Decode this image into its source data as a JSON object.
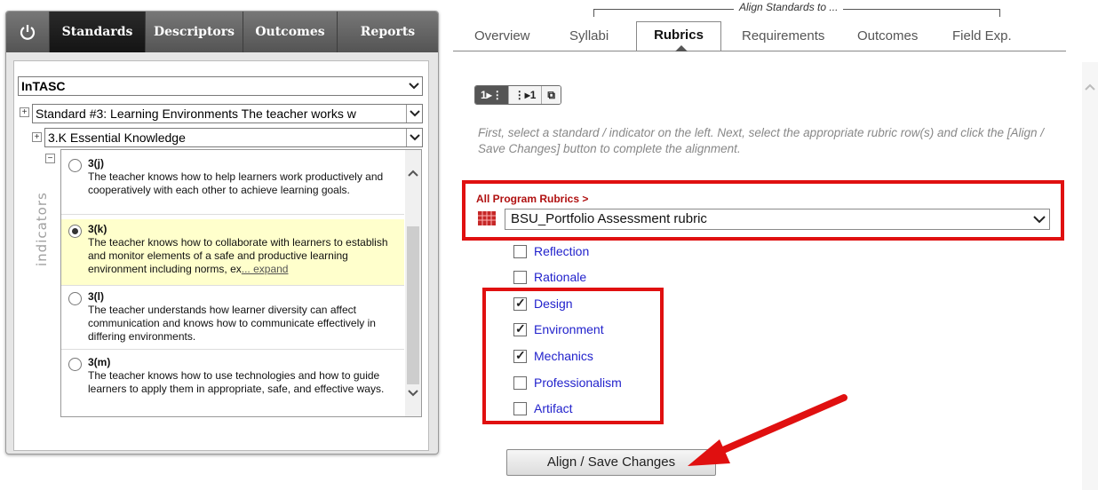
{
  "left_tabs": [
    "Standards",
    "Descriptors",
    "Outcomes",
    "Reports"
  ],
  "selects": {
    "framework": "InTASC",
    "standard": "Standard #3: Learning Environments The teacher works w",
    "knowledge": "3.K Essential Knowledge"
  },
  "indicators_label": "indicators",
  "indicators": [
    {
      "code": "3(j)",
      "text": "The teacher knows how to help learners work productively and cooperatively with each other to achieve learning goals.",
      "selected": false
    },
    {
      "code": "3(k)",
      "text": "The teacher knows how to collaborate with learners to establish and monitor elements of a safe and productive learning environment including norms, ex",
      "expand": "... expand",
      "selected": true
    },
    {
      "code": "3(l)",
      "text": "The teacher understands how learner diversity can affect communication and knows how to communicate effectively in differing environments.",
      "selected": false
    },
    {
      "code": "3(m)",
      "text": "The teacher knows how to use technologies and how to guide learners to apply them in appropriate, safe, and effective ways.",
      "selected": false
    }
  ],
  "align_group_label": "Align Standards to ...",
  "right_tabs": [
    "Overview",
    "Syllabi",
    "Rubrics",
    "Requirements",
    "Outcomes",
    "Field Exp."
  ],
  "active_right_tab": "Rubrics",
  "view_buttons": [
    "1▸⋮",
    "⋮▸1",
    "⧉"
  ],
  "instructions": "First, select a standard / indicator on the left. Next, select the appropriate rubric row(s) and click the [Align / Save Changes] button to complete the alignment.",
  "rubric_header": "All Program Rubrics >",
  "rubric_selected": "BSU_Portfolio Assessment rubric",
  "criteria": [
    {
      "label": "Reflection",
      "checked": false
    },
    {
      "label": "Rationale",
      "checked": false
    },
    {
      "label": "Design",
      "checked": true
    },
    {
      "label": "Environment",
      "checked": true
    },
    {
      "label": "Mechanics",
      "checked": true
    },
    {
      "label": "Professionalism",
      "checked": false
    },
    {
      "label": "Artifact",
      "checked": false
    }
  ],
  "save_button": "Align / Save Changes",
  "colors": {
    "highlight": "#e01010",
    "link": "#2222cc",
    "selected_row": "#ffffcc"
  }
}
